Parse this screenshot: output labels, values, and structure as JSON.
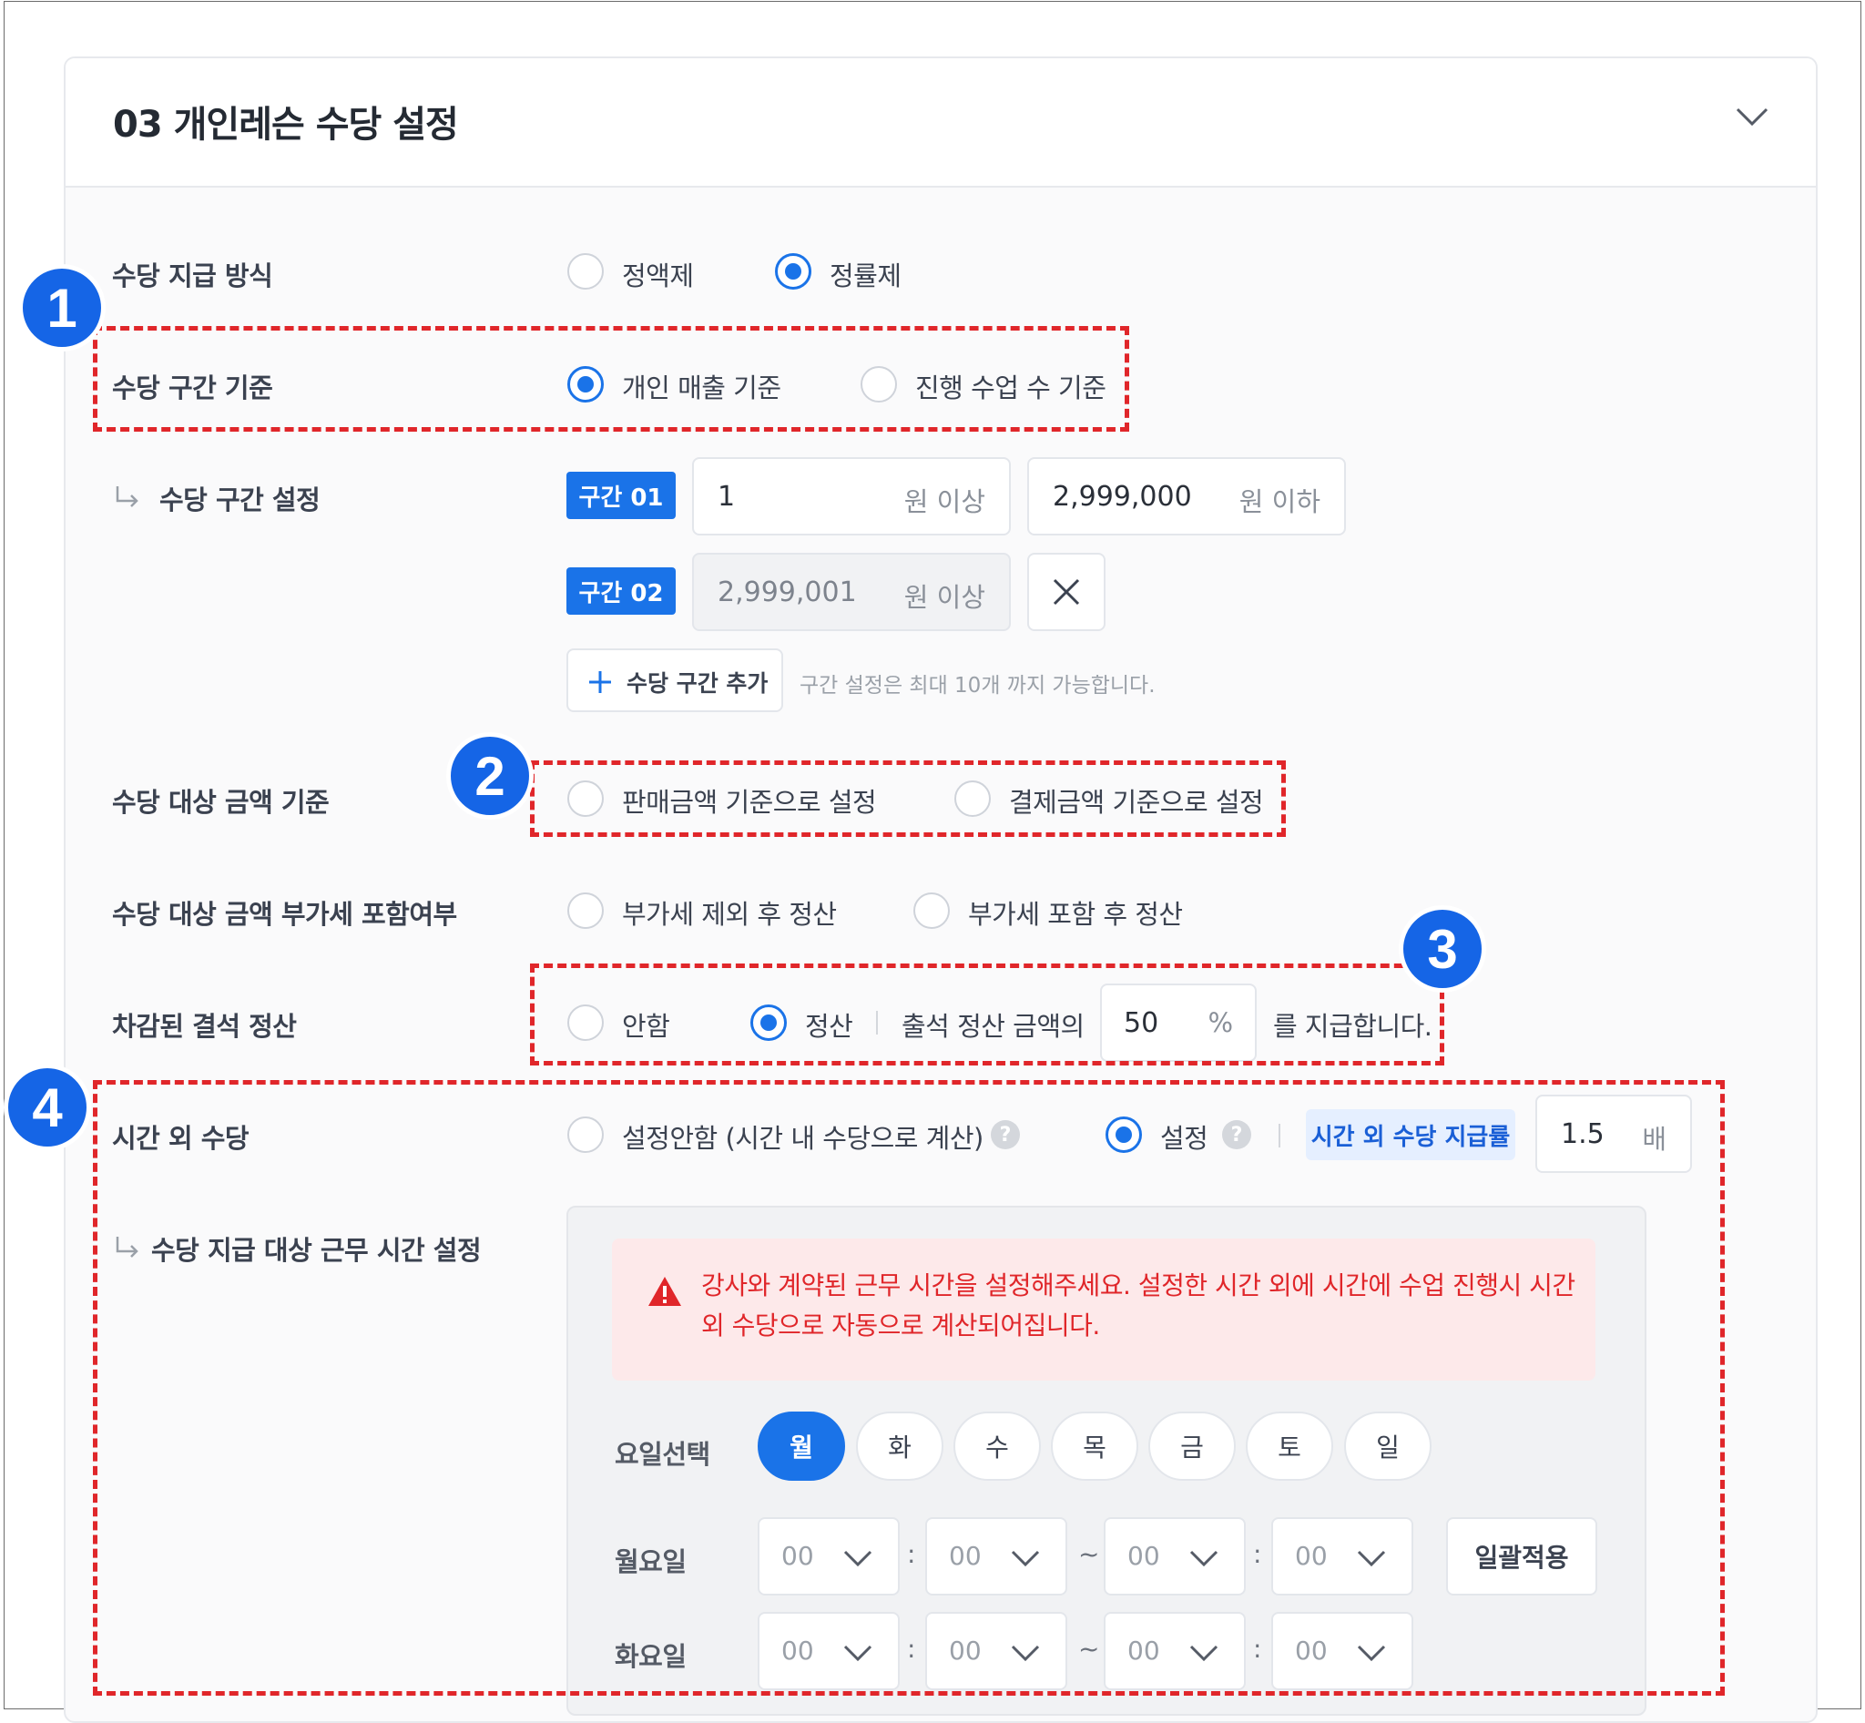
{
  "section": {
    "title": "03  개인레슨 수당 설정"
  },
  "payment_method": {
    "label": "수당 지급 방식",
    "options": [
      "정액제",
      "정률제"
    ],
    "selected": "정률제"
  },
  "tier_basis": {
    "label": "수당 구간 기준",
    "options": [
      "개인 매출 기준",
      "진행 수업 수 기준"
    ],
    "selected": "개인 매출 기준"
  },
  "tier_setting": {
    "label": "수당 구간 설정",
    "tiers": [
      {
        "tag": "구간 01",
        "from": "1",
        "from_unit": "원 이상",
        "to": "2,999,000",
        "to_unit": "원 이하"
      },
      {
        "tag": "구간 02",
        "from": "2,999,001",
        "from_unit": "원 이상"
      }
    ],
    "add_button": "수당 구간 추가",
    "hint": "구간 설정은 최대 10개 까지 가능합니다."
  },
  "amount_basis": {
    "label": "수당 대상 금액 기준",
    "options": [
      "판매금액 기준으로 설정",
      "결제금액 기준으로 설정"
    ],
    "selected": ""
  },
  "vat": {
    "label": "수당 대상 금액 부가세 포함여부",
    "options": [
      "부가세 제외 후 정산",
      "부가세 포함 후 정산"
    ],
    "selected": ""
  },
  "absence": {
    "label": "차감된 결석 정산",
    "options": [
      "안함",
      "정산"
    ],
    "selected": "정산",
    "prefix": "출석 정산 금액의",
    "value": "50",
    "unit": "%",
    "suffix": "를 지급합니다."
  },
  "overtime": {
    "label": "시간 외 수당",
    "options": [
      "설정안함 (시간 내 수당으로 계산)",
      "설정"
    ],
    "selected": "설정",
    "rate_label": "시간 외 수당 지급률",
    "rate": "1.5",
    "rate_unit": "배"
  },
  "work_hours": {
    "label": "수당 지급 대상 근무 시간 설정",
    "alert": "강사와 계약된 근무 시간을 설정해주세요. 설정한 시간 외에 시간에 수업 진행시 시간 외 수당으로 자동으로 계산되어집니다.",
    "day_label": "요일선택",
    "days": [
      "월",
      "화",
      "수",
      "목",
      "금",
      "토",
      "일"
    ],
    "selected_day": "월",
    "rows": [
      {
        "day": "월요일",
        "values": [
          "00",
          "00",
          "00",
          "00"
        ]
      },
      {
        "day": "화요일",
        "values": [
          "00",
          "00",
          "00",
          "00"
        ]
      }
    ],
    "apply_all": "일괄적용",
    "colon": ":",
    "tilde": "~"
  },
  "annotations": [
    "1",
    "2",
    "3",
    "4"
  ],
  "colors": {
    "accent": "#1a73e8",
    "annotation": "#e0262a",
    "badge": "#1565e6"
  }
}
